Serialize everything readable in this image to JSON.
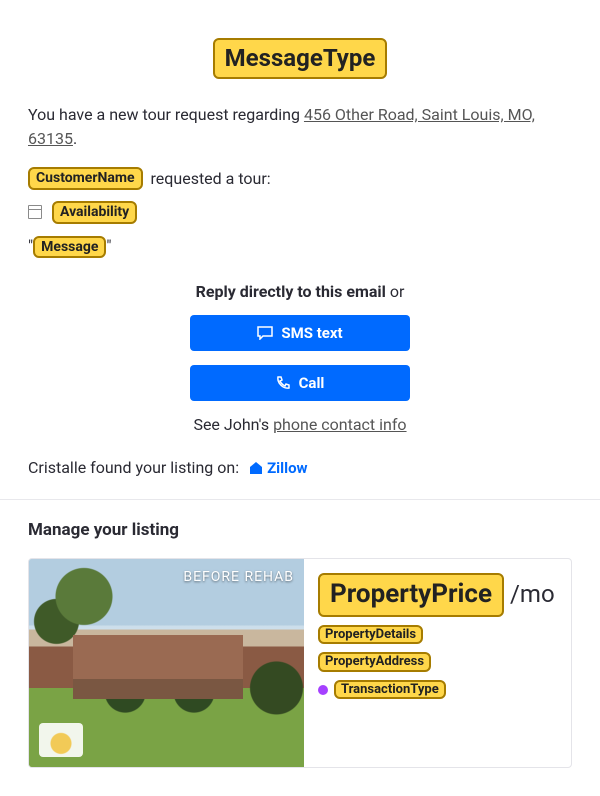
{
  "title_placeholder": "MessageType",
  "intro_prefix": "You have a new tour request regarding ",
  "intro_address": "456 Other Road, Saint Louis, MO, 63135",
  "intro_suffix": ".",
  "customer_placeholder": "CustomerName",
  "requested_text": " requested a tour:",
  "availability_placeholder": "Availability",
  "message_placeholder": "Message",
  "reply_text_strong": "Reply directly to this email",
  "reply_text_or": " or",
  "btn_sms": "SMS text",
  "btn_call": "Call",
  "contact_prefix": "See John's ",
  "contact_link": "phone contact info",
  "found_prefix": "Cristalle found your listing on:",
  "found_brand": "Zillow",
  "manage_heading": "Manage your listing",
  "photo_overlay": "BEFORE REHAB",
  "price_placeholder": "PropertyPrice",
  "price_suffix": "/mo",
  "details_placeholder": "PropertyDetails",
  "address_placeholder": "PropertyAddress",
  "transaction_placeholder": "TransactionType"
}
